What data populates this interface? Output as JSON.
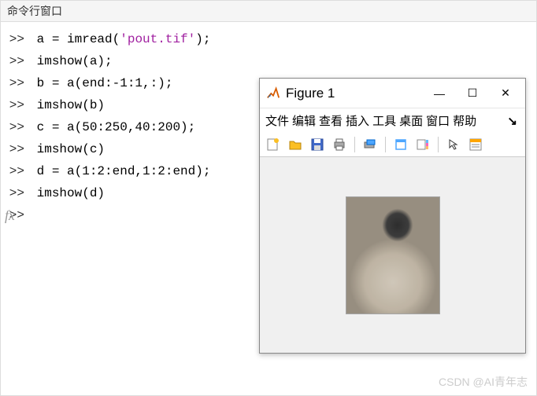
{
  "commandWindow": {
    "title": "命令行窗口",
    "prompt": ">>",
    "fxLabel": "fx",
    "lines": [
      {
        "plain": "a = imread(",
        "string": "'pout.tif'",
        "tail": ");"
      },
      {
        "plain": "imshow(a);",
        "string": "",
        "tail": ""
      },
      {
        "plain": "b = a(end:-1:1,:);",
        "string": "",
        "tail": ""
      },
      {
        "plain": "imshow(b)",
        "string": "",
        "tail": ""
      },
      {
        "plain": "c = a(50:250,40:200);",
        "string": "",
        "tail": ""
      },
      {
        "plain": "imshow(c)",
        "string": "",
        "tail": ""
      },
      {
        "plain": "d = a(1:2:end,1:2:end);",
        "string": "",
        "tail": ""
      },
      {
        "plain": "imshow(d)",
        "string": "",
        "tail": ""
      },
      {
        "plain": "",
        "string": "",
        "tail": ""
      }
    ]
  },
  "figureWindow": {
    "title": "Figure 1",
    "menus": [
      "文件",
      "编辑",
      "查看",
      "插入",
      "工具",
      "桌面",
      "窗口",
      "帮助"
    ],
    "menuMore": "↘",
    "winControls": {
      "min": "—",
      "max": "☐",
      "close": "✕"
    },
    "toolbarIcons": [
      "new-figure-icon",
      "open-icon",
      "save-icon",
      "print-icon",
      "sep",
      "data-cursor-icon",
      "sep",
      "link-icon",
      "colorbar-icon",
      "sep",
      "arrow-icon",
      "insert-legend-icon"
    ]
  },
  "watermark": "CSDN @AI青年志"
}
